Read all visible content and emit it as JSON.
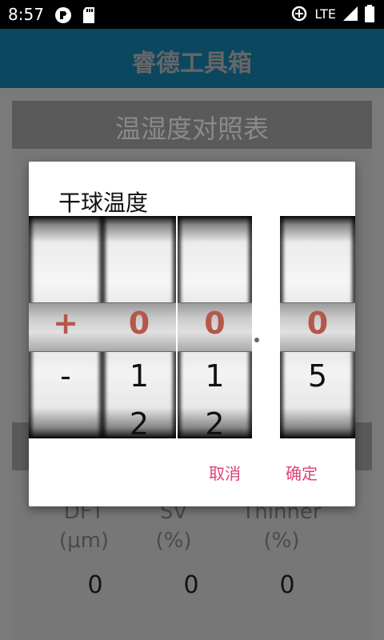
{
  "status": {
    "time": "8:57",
    "network": "LTE"
  },
  "app": {
    "title": "睿德工具箱"
  },
  "section": {
    "title": "温湿度对照表"
  },
  "columns": [
    {
      "label_line1": "DFT",
      "label_line2": "(μm)",
      "value": "0"
    },
    {
      "label_line1": "SV",
      "label_line2": "(%)",
      "value": "0"
    },
    {
      "label_line1": "Thinner",
      "label_line2": "(%)",
      "value": "0"
    }
  ],
  "dialog": {
    "title": "干球温度",
    "wheels": [
      {
        "selected": "+",
        "next1": "-",
        "next2": ""
      },
      {
        "selected": "0",
        "next1": "1",
        "next2": "2"
      },
      {
        "selected": "0",
        "next1": "1",
        "next2": "2"
      },
      {
        "selected": "0",
        "next1": "5",
        "next2": ""
      }
    ],
    "cancel_label": "取消",
    "confirm_label": "确定"
  },
  "colors": {
    "accent": "#e0407a",
    "selected_digit": "#b5574a",
    "app_bar": "#0c4760"
  }
}
